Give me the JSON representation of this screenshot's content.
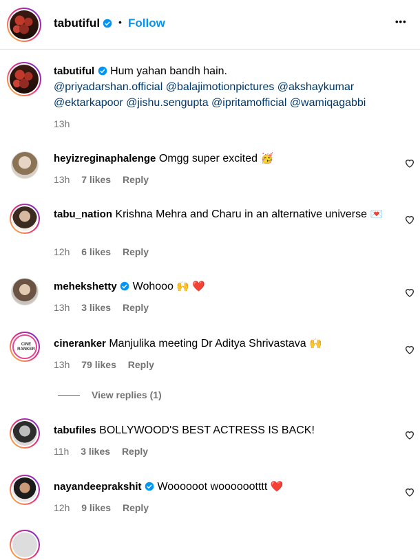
{
  "header": {
    "username": "tabutiful",
    "dot": "•",
    "follow": "Follow",
    "more": "•••"
  },
  "caption": {
    "username": "tabutiful",
    "text": "Hum yahan bandh hain.",
    "mentions_line1": "@priyadarshan.official @balajimotionpictures @akshaykumar",
    "mentions_line2": "@ektarkapoor @jishu.sengupta @ipritamofficial @wamiqagabbi",
    "time": "13h"
  },
  "comments": [
    {
      "username": "heyizreginaphalenge",
      "text": "Omgg super excited",
      "emoji": "🥳",
      "time": "13h",
      "likes": "7 likes",
      "reply": "Reply",
      "verified": false
    },
    {
      "username": "tabu_nation",
      "text": "Krishna Mehra and Charu in an alternative universe",
      "emoji": "💌",
      "time": "12h",
      "likes": "6 likes",
      "reply": "Reply",
      "verified": false
    },
    {
      "username": "mehekshetty",
      "text": "Wohooo",
      "emoji": "🙌 ❤️",
      "time": "13h",
      "likes": "3 likes",
      "reply": "Reply",
      "verified": true
    },
    {
      "username": "cineranker",
      "text": "Manjulika meeting Dr Aditya Shrivastava",
      "emoji": "🙌",
      "time": "13h",
      "likes": "79 likes",
      "reply": "Reply",
      "verified": false
    },
    {
      "username": "tabufiles",
      "text": "BOLLYWOOD'S BEST ACTRESS IS BACK!",
      "emoji": "",
      "time": "11h",
      "likes": "3 likes",
      "reply": "Reply",
      "verified": false
    },
    {
      "username": "nayandeeprakshit",
      "text": "Woooooot wooooootttt",
      "emoji": "❤️",
      "time": "12h",
      "likes": "9 likes",
      "reply": "Reply",
      "verified": true
    }
  ],
  "view_replies": "View replies (1)",
  "cineranker_logo": "CINE RANKER",
  "colors": {
    "accent": "#0095f6",
    "link": "#00376b",
    "muted": "#737373",
    "verified": "#0095f6"
  }
}
